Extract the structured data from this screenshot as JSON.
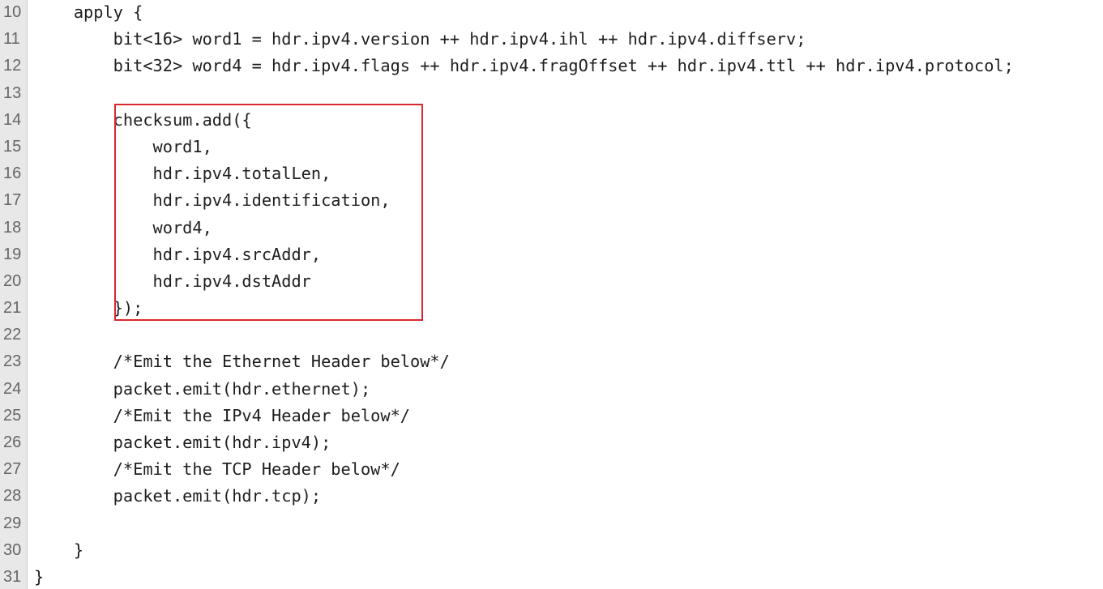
{
  "editor": {
    "lines": [
      {
        "number": "10",
        "text": "    apply {"
      },
      {
        "number": "11",
        "text": "        bit<16> word1 = hdr.ipv4.version ++ hdr.ipv4.ihl ++ hdr.ipv4.diffserv;"
      },
      {
        "number": "12",
        "text": "        bit<32> word4 = hdr.ipv4.flags ++ hdr.ipv4.fragOffset ++ hdr.ipv4.ttl ++ hdr.ipv4.protocol;"
      },
      {
        "number": "13",
        "text": ""
      },
      {
        "number": "14",
        "text": "        checksum.add({"
      },
      {
        "number": "15",
        "text": "            word1,"
      },
      {
        "number": "16",
        "text": "            hdr.ipv4.totalLen,"
      },
      {
        "number": "17",
        "text": "            hdr.ipv4.identification,"
      },
      {
        "number": "18",
        "text": "            word4,"
      },
      {
        "number": "19",
        "text": "            hdr.ipv4.srcAddr,"
      },
      {
        "number": "20",
        "text": "            hdr.ipv4.dstAddr"
      },
      {
        "number": "21",
        "text": "        });"
      },
      {
        "number": "22",
        "text": ""
      },
      {
        "number": "23",
        "text": "        /*Emit the Ethernet Header below*/"
      },
      {
        "number": "24",
        "text": "        packet.emit(hdr.ethernet);"
      },
      {
        "number": "25",
        "text": "        /*Emit the IPv4 Header below*/"
      },
      {
        "number": "26",
        "text": "        packet.emit(hdr.ipv4);"
      },
      {
        "number": "27",
        "text": "        /*Emit the TCP Header below*/"
      },
      {
        "number": "28",
        "text": "        packet.emit(hdr.tcp);"
      },
      {
        "number": "29",
        "text": ""
      },
      {
        "number": "30",
        "text": "    }"
      },
      {
        "number": "31",
        "text": "}"
      }
    ],
    "highlight_color": "#d9272e"
  }
}
